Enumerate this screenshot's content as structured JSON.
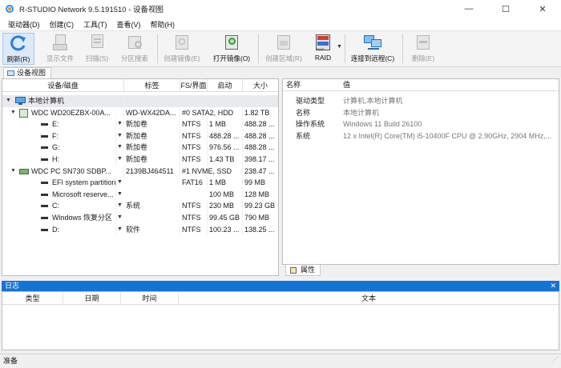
{
  "window": {
    "title": "R-STUDIO Network 9.5.191510 - 设备视图",
    "controls": [
      "—",
      "☐",
      "✕"
    ]
  },
  "menu": [
    "驱动器(D)",
    "创建(C)",
    "工具(T)",
    "查看(V)",
    "帮助(H)"
  ],
  "toolbar": {
    "refresh": "刷新(R)",
    "show_files": "显示文件",
    "scan": "扫描(S)",
    "partition_search": "分区搜索",
    "create_image": "创建镜像(E)",
    "open_image": "打开镜像(O)",
    "create_region": "创建区域(R)",
    "raid": "RAID",
    "raid_icon_text": "RAID",
    "connect_remote": "连接到远程(C)",
    "delete": "删除(E)"
  },
  "tab": {
    "label": "设备视图"
  },
  "tree": {
    "columns": [
      "设备/磁盘",
      "标签",
      "FS/界面",
      "启动",
      "大小"
    ],
    "rows": [
      {
        "name": "本地计算机",
        "label": "",
        "fs": "",
        "start": "",
        "size": ""
      },
      {
        "name": "WDC WD20EZBX-00A...",
        "label": "WD-WX42DA...",
        "fs": "#0 SATA2, HDD",
        "start": "1.82 TB",
        "size": ""
      },
      {
        "name": "E:",
        "label": "新加卷",
        "fs": "NTFS",
        "start": "1 MB",
        "size": "488.28 ..."
      },
      {
        "name": "F:",
        "label": "新加卷",
        "fs": "NTFS",
        "start": "488.28 ...",
        "size": "488.28 ..."
      },
      {
        "name": "G:",
        "label": "新加卷",
        "fs": "NTFS",
        "start": "976.56 ...",
        "size": "488.28 ..."
      },
      {
        "name": "H:",
        "label": "新加卷",
        "fs": "NTFS",
        "start": "1.43 TB",
        "size": "398.17 ..."
      },
      {
        "name": "WDC PC SN730 SDBP...",
        "label": "2139BJ464511",
        "fs": "#1 NVME, SSD",
        "start": "238.47 ...",
        "size": ""
      },
      {
        "name": "EFI system partition",
        "label": "",
        "fs": "FAT16",
        "start": "1 MB",
        "size": "99 MB"
      },
      {
        "name": "Microsoft reserve...",
        "label": "",
        "fs": "",
        "start": "100 MB",
        "size": "128 MB"
      },
      {
        "name": "C:",
        "label": "系统",
        "fs": "NTFS",
        "start": "230 MB",
        "size": "99.23 GB"
      },
      {
        "name": "Windows 恢复分区",
        "label": "",
        "fs": "NTFS",
        "start": "99.45 GB",
        "size": "790 MB"
      },
      {
        "name": "D:",
        "label": "软件",
        "fs": "NTFS",
        "start": "100.23 ...",
        "size": "138.25 ..."
      }
    ]
  },
  "properties": {
    "columns": [
      "名称",
      "值"
    ],
    "rows": [
      {
        "name": "驱动类型",
        "value": "计算机,本地计算机"
      },
      {
        "name": "名称",
        "value": "本地计算机"
      },
      {
        "name": "操作系统",
        "value": "Windows 11 Build 26100"
      },
      {
        "name": "系统",
        "value": "12 x Intel(R) Core(TM) i5-10400F CPU @ 2.90GHz, 2904 MHz,..."
      }
    ],
    "tab_label": "属性"
  },
  "log": {
    "title": "日志",
    "close": "✕",
    "columns": [
      "类型",
      "日期",
      "时间",
      "文本"
    ]
  },
  "status": {
    "text": "准备"
  }
}
